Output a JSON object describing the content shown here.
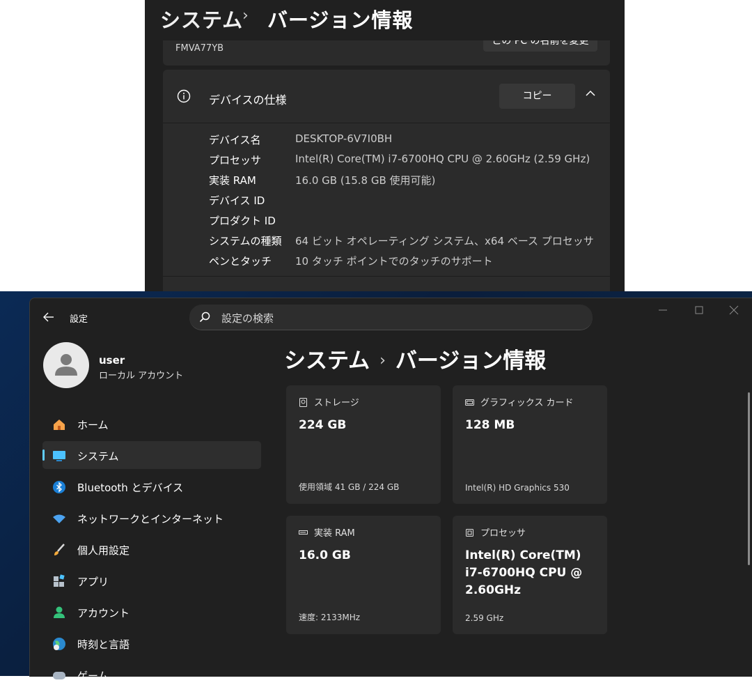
{
  "top_window": {
    "breadcrumb_parent": "システム",
    "breadcrumb_sep": "›",
    "breadcrumb_current": "バージョン情報",
    "pc_name": "FMVA77YB",
    "rename_button": "この PC の名前を変更",
    "spec_section_title": "デバイスの仕様",
    "copy_button": "コピー",
    "specs": [
      {
        "key": "デバイス名",
        "value": "DESKTOP-6V7I0BH"
      },
      {
        "key": "プロセッサ",
        "value": "Intel(R) Core(TM) i7-6700HQ CPU @ 2.60GHz (2.59 GHz)"
      },
      {
        "key": "実装 RAM",
        "value": "16.0 GB (15.8 GB 使用可能)"
      },
      {
        "key": "デバイス ID",
        "value": ""
      },
      {
        "key": "プロダクト ID",
        "value": ""
      },
      {
        "key": "システムの種類",
        "value": "64 ビット オペレーティング システム、x64 ベース プロセッサ"
      },
      {
        "key": "ペンとタッチ",
        "value": "10 タッチ ポイントでのタッチのサポート"
      }
    ]
  },
  "main_window": {
    "app_title": "設定",
    "search_placeholder": "設定の検索",
    "user": {
      "name": "user",
      "account_type": "ローカル アカウント"
    },
    "nav": [
      {
        "label": "ホーム",
        "icon": "home-icon"
      },
      {
        "label": "システム",
        "icon": "system-icon",
        "active": true
      },
      {
        "label": "Bluetooth とデバイス",
        "icon": "bluetooth-icon"
      },
      {
        "label": "ネットワークとインターネット",
        "icon": "wifi-icon"
      },
      {
        "label": "個人用設定",
        "icon": "brush-icon"
      },
      {
        "label": "アプリ",
        "icon": "apps-icon"
      },
      {
        "label": "アカウント",
        "icon": "account-icon"
      },
      {
        "label": "時刻と言語",
        "icon": "globe-clock-icon"
      },
      {
        "label": "ゲーム",
        "icon": "game-icon"
      }
    ],
    "title_parent": "システム",
    "title_sep": "›",
    "title_current": "バージョン情報",
    "cards": {
      "storage": {
        "title": "ストレージ",
        "value": "224 GB",
        "sub": "使用領域 41 GB / 224 GB"
      },
      "gpu": {
        "title": "グラフィックス カード",
        "value": "128 MB",
        "sub": "Intel(R) HD Graphics 530"
      },
      "ram": {
        "title": "実装 RAM",
        "value": "16.0 GB",
        "sub": "速度: 2133MHz"
      },
      "cpu": {
        "title": "プロセッサ",
        "value": "Intel(R) Core(TM) i7-6700HQ CPU @ 2.60GHz",
        "sub": "2.59 GHz"
      }
    }
  },
  "colors": {
    "accent": "#60cdff",
    "window_bg": "#202020",
    "card_bg": "#2b2b2b"
  }
}
